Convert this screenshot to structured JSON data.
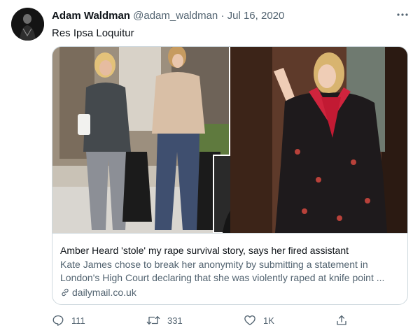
{
  "tweet": {
    "author_name": "Adam Waldman",
    "handle": "@adam_waldman",
    "separator": "·",
    "date": "Jul 16, 2020",
    "text": "Res Ipsa Loquitur",
    "more_icon": "more-dots-icon"
  },
  "card": {
    "title": "Amber Heard 'stole' my rape survival story, says her fired assistant",
    "description": "Kate James chose to break her anonymity by submitting a statement in London's High Court declaring that she was violently raped at knife point ...",
    "domain": "dailymail.co.uk",
    "domain_icon": "link-icon"
  },
  "actions": {
    "reply_count": "111",
    "retweet_count": "331",
    "like_count": "1K",
    "reply_icon": "reply-icon",
    "retweet_icon": "retweet-icon",
    "like_icon": "heart-icon",
    "share_icon": "share-icon"
  }
}
